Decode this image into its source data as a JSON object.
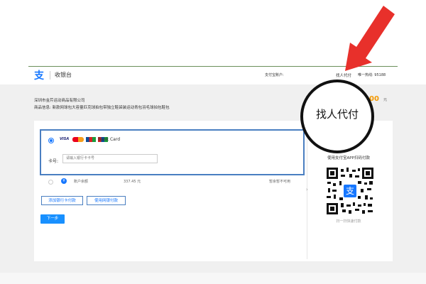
{
  "header": {
    "brand": "收银台",
    "account_label": "支付宝账户:",
    "finder_label": "找人代付",
    "hotline": "唯一热线: 95188"
  },
  "order": {
    "merchant": "深圳市金芹运动商品有限公司",
    "goods": "商品信息: 新款网球包大容量匹克球拍包带独立鞋袋装运动青包羽毛球拍包鞋包",
    "amount": "00",
    "currency": "元"
  },
  "card": {
    "brands": [
      "VISA",
      "",
      "JCB",
      ""
    ],
    "bank_card_label": "Bank Card",
    "card_no_label": "卡号:",
    "card_no_placeholder": "请输入银行卡卡号"
  },
  "balance": {
    "label": "账户余额",
    "amount": "337.45 元",
    "status": "暂余暂不可用"
  },
  "buttons": {
    "add_card": "添加银行卡付款",
    "online_bank": "使用网银付款",
    "next": "下一步"
  },
  "qr": {
    "title": "使用支付宝APP扫码付款",
    "caption": "扫一扫快速付款"
  },
  "annotation": {
    "circle_text": "找人代付",
    "arrow_color": "#e8302b"
  }
}
